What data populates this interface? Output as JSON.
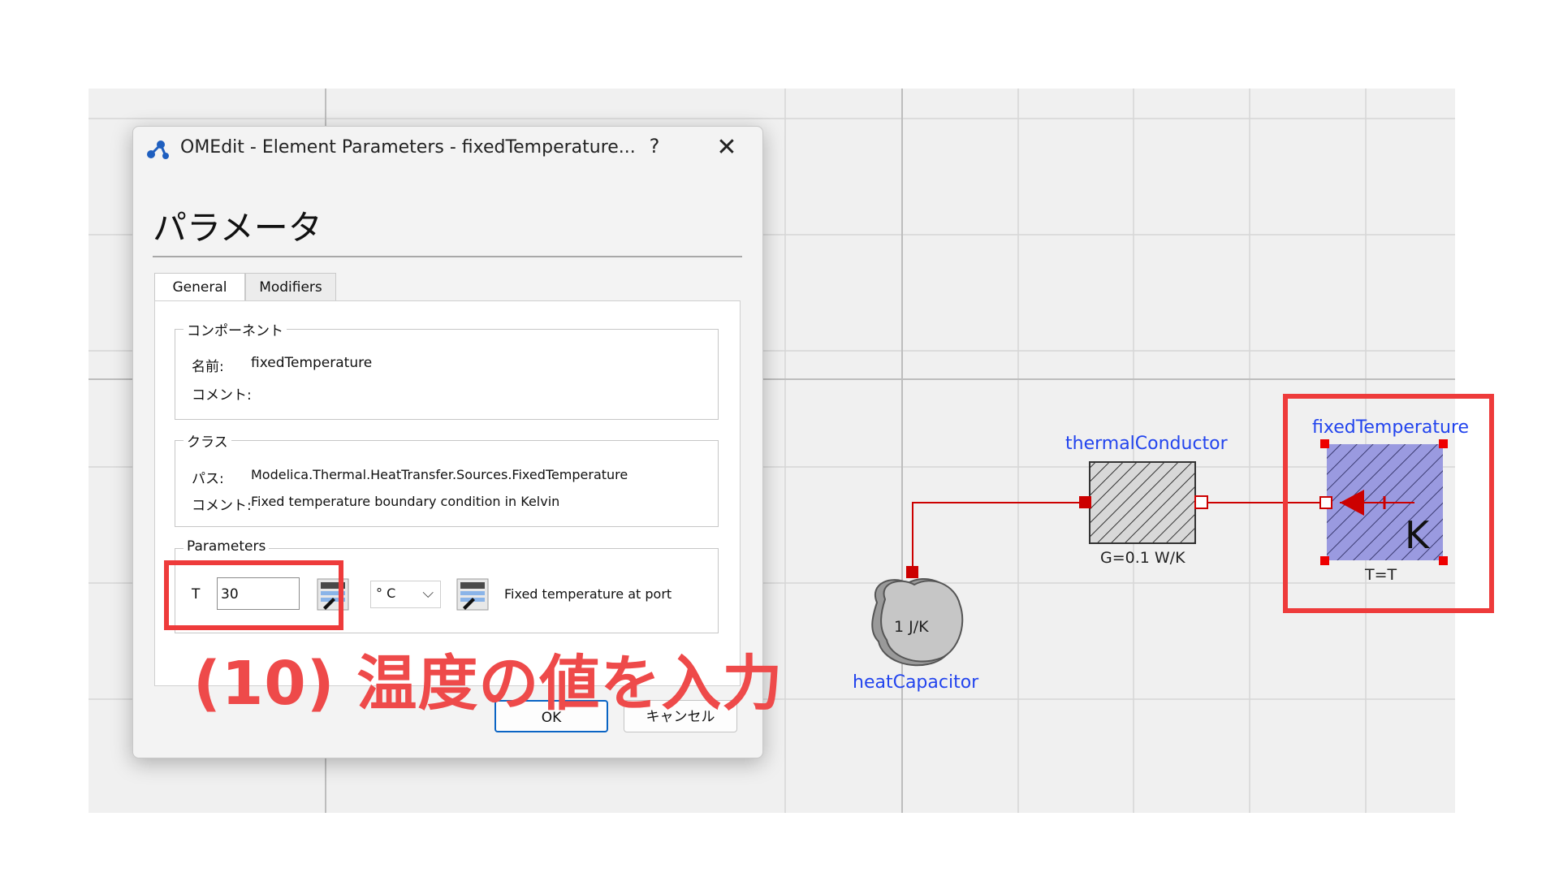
{
  "dialog": {
    "title": "OMEdit - Element Parameters - fixedTemperature...",
    "help_label": "?",
    "close_label": "✕",
    "heading": "パラメータ",
    "tabs": [
      {
        "label": "General",
        "active": true
      },
      {
        "label": "Modifiers",
        "active": false
      }
    ],
    "component_group": {
      "title": "コンポーネント",
      "name_label": "名前:",
      "name_value": "fixedTemperature",
      "comment_label": "コメント:",
      "comment_value": ""
    },
    "class_group": {
      "title": "クラス",
      "path_label": "パス:",
      "path_value": "Modelica.Thermal.HeatTransfer.Sources.FixedTemperature",
      "comment_label": "コメント:",
      "comment_value": "Fixed temperature boundary condition in Kelvin"
    },
    "parameters_group": {
      "title": "Parameters",
      "param_label": "T",
      "param_value": "30",
      "unit_value": "° C",
      "unit_chevron": "⌵",
      "description": "Fixed temperature at port"
    },
    "ok_label": "OK",
    "cancel_label": "キャンセル"
  },
  "diagram": {
    "thermal_conductor": {
      "name": "thermalConductor",
      "param": "G=0.1 W/K"
    },
    "fixed_temperature": {
      "name": "fixedTemperature",
      "param": "T=T",
      "icon_letter": "K"
    },
    "heat_capacitor": {
      "name": "heatCapacitor",
      "param": "1 J/K"
    }
  },
  "annotation": {
    "text": "(10) 温度の値を入力",
    "color": "#ee4a4a"
  },
  "colors": {
    "accent_blue": "#2244ee",
    "connector_red": "#cc0000",
    "highlight_red": "#ee3b3b",
    "fixed_temp_fill": "#9a9ae0"
  }
}
